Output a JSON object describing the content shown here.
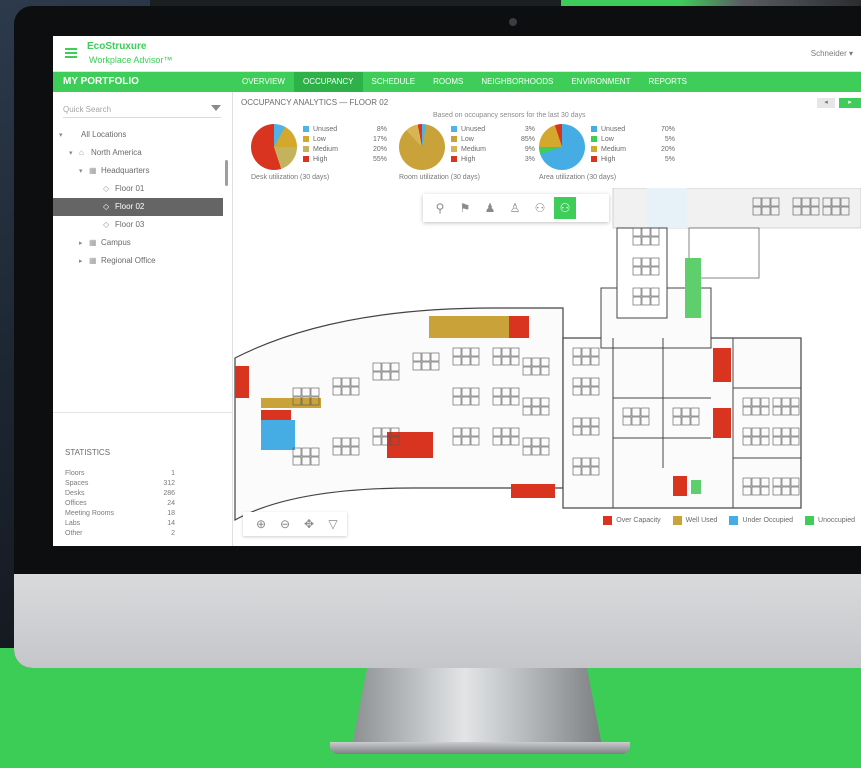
{
  "app": {
    "brand": "EcoStruxure",
    "subtitle": "Workplace Advisor™",
    "user_menu": "Schneider ▾"
  },
  "nav": {
    "section_title": "MY PORTFOLIO",
    "tabs": [
      {
        "label": "OVERVIEW"
      },
      {
        "label": "OCCUPANCY"
      },
      {
        "label": "SCHEDULE"
      },
      {
        "label": "ROOMS"
      },
      {
        "label": "NEIGHBORHOODS"
      },
      {
        "label": "ENVIRONMENT"
      },
      {
        "label": "REPORTS"
      }
    ]
  },
  "sidebar": {
    "search_placeholder": "Quick Search",
    "tree": [
      {
        "label": "All Locations",
        "toggle": "▾",
        "icon": ""
      },
      {
        "label": "North America",
        "toggle": "▾",
        "icon": "⌂"
      },
      {
        "label": "Headquarters",
        "toggle": "▾",
        "icon": "▦"
      },
      {
        "label": "Floor 01",
        "toggle": "",
        "icon": "◇"
      },
      {
        "label": "Floor 02",
        "toggle": "",
        "icon": "◇"
      },
      {
        "label": "Floor 03",
        "toggle": "",
        "icon": "◇"
      },
      {
        "label": "Campus",
        "toggle": "▸",
        "icon": "▦"
      },
      {
        "label": "Regional Office",
        "toggle": "▸",
        "icon": "▦"
      }
    ],
    "selected_index": 4,
    "stats_title": "STATISTICS",
    "stats": [
      {
        "label": "Floors",
        "value": "1"
      },
      {
        "label": "Spaces",
        "value": "312"
      },
      {
        "label": "Desks",
        "value": "286"
      },
      {
        "label": "Offices",
        "value": "24"
      },
      {
        "label": "Meeting Rooms",
        "value": "18"
      },
      {
        "label": "Labs",
        "value": "14"
      },
      {
        "label": "Other",
        "value": "2"
      }
    ]
  },
  "main": {
    "breadcrumb": "OCCUPANCY ANALYTICS — FLOOR 02",
    "btn_secondary": "◂",
    "btn_primary": "▸",
    "summary_caption": "Based on occupancy sensors for the last 30 days",
    "pies": [
      {
        "caption": "Desk utilization (30 days)",
        "slices": [
          {
            "name": "Unused",
            "value": 8,
            "color": "#4fb3e6"
          },
          {
            "name": "Low",
            "value": 17,
            "color": "#d4a82d"
          },
          {
            "name": "Medium",
            "value": 20,
            "color": "#c3b35c"
          },
          {
            "name": "High",
            "value": 55,
            "color": "#d9341f"
          }
        ],
        "labels": [
          "8%",
          "17%",
          "20%",
          "55%"
        ]
      },
      {
        "caption": "Room utilization (30 days)",
        "slices": [
          {
            "name": "Unused",
            "value": 3,
            "color": "#4fb3e6"
          },
          {
            "name": "Low",
            "value": 85,
            "color": "#c9a23a"
          },
          {
            "name": "Medium",
            "value": 9,
            "color": "#d9b454"
          },
          {
            "name": "High",
            "value": 3,
            "color": "#d9341f"
          }
        ],
        "labels": [
          "3%",
          "85%",
          "9%",
          "3%"
        ]
      },
      {
        "caption": "Area utilization (30 days)",
        "slices": [
          {
            "name": "Unused",
            "value": 70,
            "color": "#45ade3"
          },
          {
            "name": "Low",
            "value": 5,
            "color": "#3dcd58"
          },
          {
            "name": "Medium",
            "value": 20,
            "color": "#d4a82d"
          },
          {
            "name": "High",
            "value": 5,
            "color": "#d9341f"
          }
        ],
        "labels": [
          "70%",
          "5%",
          "20%",
          "5%"
        ]
      }
    ],
    "tools": [
      {
        "icon": "person-icon",
        "glyph": "⚲"
      },
      {
        "icon": "group-icon",
        "glyph": "⚑"
      },
      {
        "icon": "meeting-icon",
        "glyph": "♟"
      },
      {
        "icon": "walk-icon",
        "glyph": "♙"
      },
      {
        "icon": "team-icon",
        "glyph": "⚇"
      },
      {
        "icon": "heatmap-icon",
        "glyph": "⚇"
      }
    ],
    "active_tool": 5,
    "zoom_tools": [
      {
        "icon": "zoom-in-icon",
        "glyph": "⊕"
      },
      {
        "icon": "zoom-out-icon",
        "glyph": "⊖"
      },
      {
        "icon": "pan-icon",
        "glyph": "✥"
      },
      {
        "icon": "filter-icon",
        "glyph": "▽"
      }
    ]
  },
  "map_legend": [
    {
      "label": "Over Capacity",
      "color": "#d9341f"
    },
    {
      "label": "Well Used",
      "color": "#c9a23a"
    },
    {
      "label": "Under Occupied",
      "color": "#45ade3"
    },
    {
      "label": "Unoccupied",
      "color": "#3dcd58"
    }
  ]
}
